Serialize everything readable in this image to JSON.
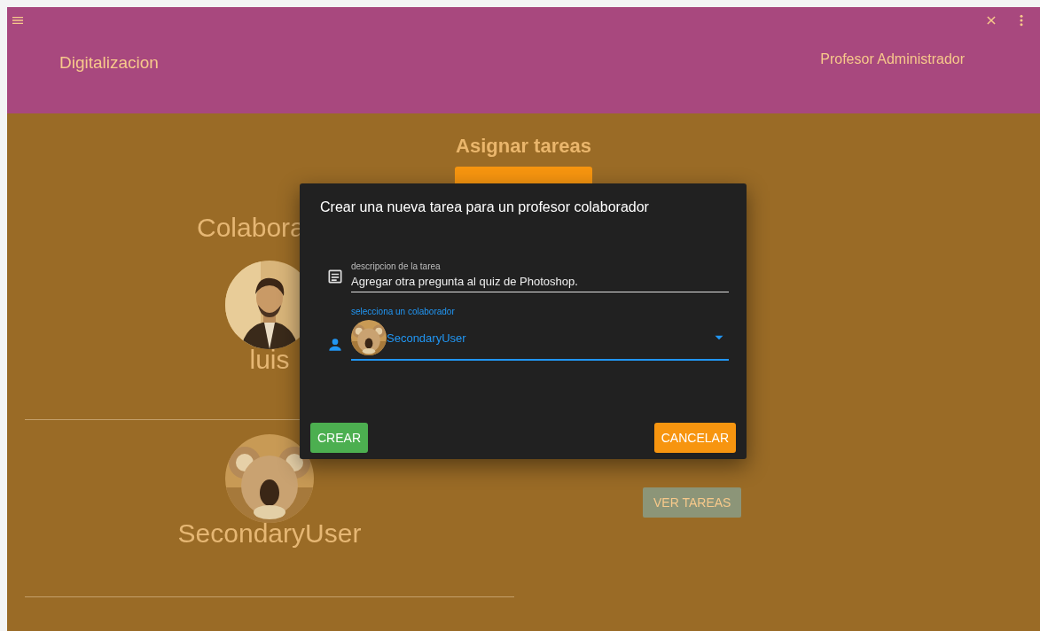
{
  "app_bar": {
    "title": "Digitalizacion",
    "user": "Profesor Administrador"
  },
  "page": {
    "title": "Asignar tareas",
    "collaborators_heading": "Colabora",
    "collaborators": [
      {
        "name": "luis"
      },
      {
        "name": "SecondaryUser",
        "button": "VER TAREAS"
      }
    ]
  },
  "dialog": {
    "title": "Crear una nueva tarea para un profesor colaborador",
    "description_field": {
      "label": "descripcion de la tarea",
      "value": "Agregar otra pregunta al quiz de Photoshop.",
      "focused": false
    },
    "collaborator_select": {
      "label": "selecciona un colaborador",
      "value": "SecondaryUser",
      "focused": true
    },
    "buttons": [
      {
        "label": "CREAR",
        "kind": "confirm"
      },
      {
        "label": "CANCELAR",
        "kind": "cancel"
      }
    ]
  }
}
